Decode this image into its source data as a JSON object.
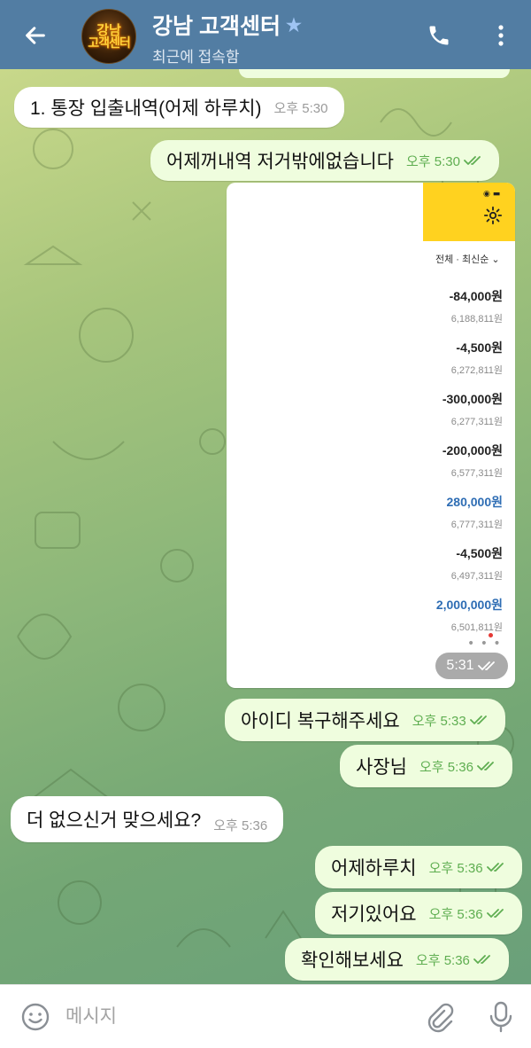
{
  "header": {
    "title": "강남 고객센터",
    "status": "최근에 접속함",
    "avatar_text_line1": "강남",
    "avatar_text_line2": "고객센터"
  },
  "messages": [
    {
      "direction": "in",
      "text": "1. 통장 입출내역(어제 하루치)",
      "time": "오후 5:30"
    },
    {
      "direction": "out",
      "text": "어제꺼내역 저거밖에없습니다",
      "time": "오후 5:30"
    },
    {
      "direction": "out",
      "type": "image",
      "time": "5:31"
    },
    {
      "direction": "out",
      "text": "아이디 복구해주세요",
      "time": "오후 5:33"
    },
    {
      "direction": "out",
      "text": "사장님",
      "time": "오후 5:36"
    },
    {
      "direction": "in",
      "text": "더 없으신거 맞으세요?",
      "time": "오후 5:36"
    },
    {
      "direction": "out",
      "text": "어제하루치",
      "time": "오후 5:36"
    },
    {
      "direction": "out",
      "text": "저기있어요",
      "time": "오후 5:36"
    },
    {
      "direction": "out",
      "text": "확인해보세요",
      "time": "오후 5:36"
    }
  ],
  "image_content": {
    "filter_label": "전체 · 최신순",
    "transactions": [
      {
        "amount": "-84,000원",
        "balance": "6,188,811원",
        "positive": false
      },
      {
        "amount": "-4,500원",
        "balance": "6,272,811원",
        "positive": false
      },
      {
        "amount": "-300,000원",
        "balance": "6,277,311원",
        "positive": false
      },
      {
        "amount": "-200,000원",
        "balance": "6,577,311원",
        "positive": false
      },
      {
        "amount": "280,000원",
        "balance": "6,777,311원",
        "positive": true
      },
      {
        "amount": "-4,500원",
        "balance": "6,497,311원",
        "positive": false
      },
      {
        "amount": "2,000,000원",
        "balance": "6,501,811원",
        "positive": true
      }
    ]
  },
  "composer": {
    "placeholder": "메시지"
  },
  "colors": {
    "header_bg": "#527da3",
    "outgoing_bubble": "#effdde",
    "incoming_bubble": "#ffffff",
    "read_check": "#5fae51",
    "positive_amount": "#2e6db4",
    "bank_app_yellow": "#ffd21f"
  },
  "icons": [
    "back-arrow-icon",
    "star-icon",
    "phone-icon",
    "more-vertical-icon",
    "double-check-icon",
    "gear-icon",
    "emoji-icon",
    "attach-icon",
    "mic-icon"
  ]
}
